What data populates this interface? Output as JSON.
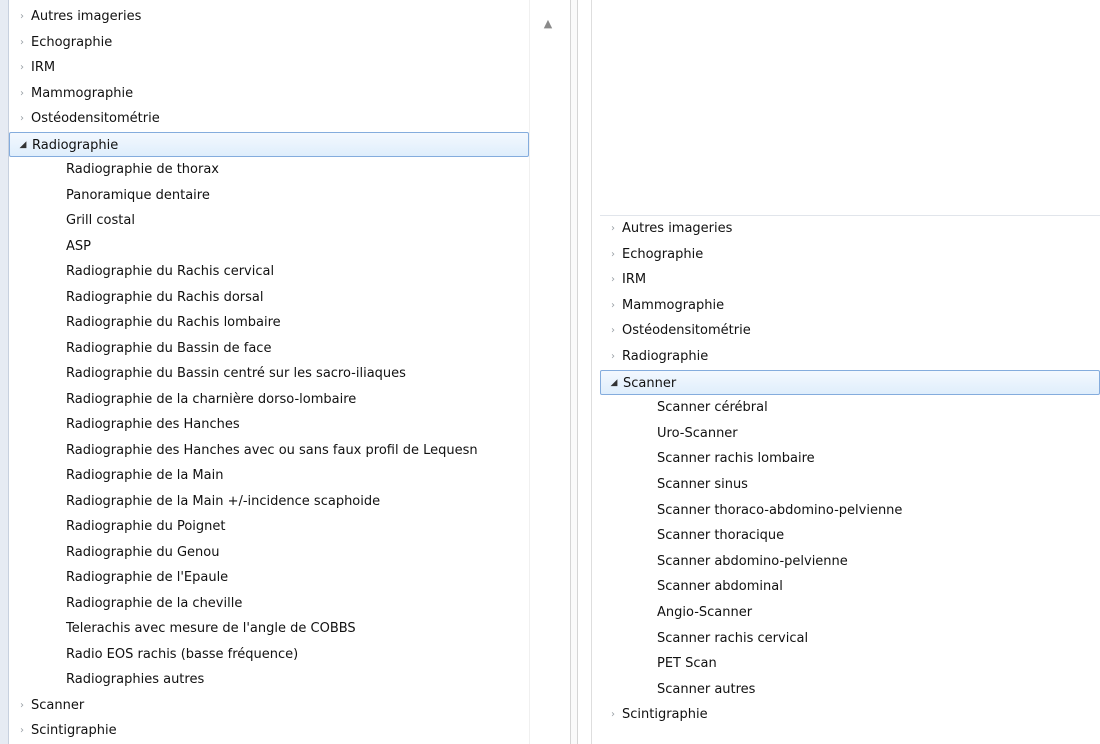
{
  "left_tree": {
    "items": [
      {
        "label": "Autres imageries",
        "level": 0,
        "expanded": false
      },
      {
        "label": "Echographie",
        "level": 0,
        "expanded": false
      },
      {
        "label": "IRM",
        "level": 0,
        "expanded": false
      },
      {
        "label": "Mammographie",
        "level": 0,
        "expanded": false
      },
      {
        "label": "Ostéodensitométrie",
        "level": 0,
        "expanded": false
      },
      {
        "label": "Radiographie",
        "level": 0,
        "expanded": true,
        "selected": true
      },
      {
        "label": "Radiographie de thorax",
        "level": 1
      },
      {
        "label": "Panoramique dentaire",
        "level": 1
      },
      {
        "label": "Grill costal",
        "level": 1
      },
      {
        "label": "ASP",
        "level": 1
      },
      {
        "label": "Radiographie du Rachis cervical",
        "level": 1
      },
      {
        "label": "Radiographie du Rachis dorsal",
        "level": 1
      },
      {
        "label": "Radiographie du Rachis lombaire",
        "level": 1
      },
      {
        "label": "Radiographie du Bassin de face",
        "level": 1
      },
      {
        "label": "Radiographie du Bassin centré sur les sacro-iliaques",
        "level": 1
      },
      {
        "label": "Radiographie de la charnière dorso-lombaire",
        "level": 1
      },
      {
        "label": "Radiographie des Hanches",
        "level": 1
      },
      {
        "label": "Radiographie des Hanches avec ou sans faux profil de Lequesn",
        "level": 1
      },
      {
        "label": "Radiographie de la Main",
        "level": 1
      },
      {
        "label": "Radiographie de la Main +/-incidence scaphoide",
        "level": 1
      },
      {
        "label": "Radiographie du Poignet",
        "level": 1
      },
      {
        "label": "Radiographie du Genou",
        "level": 1
      },
      {
        "label": "Radiographie de l'Epaule",
        "level": 1
      },
      {
        "label": "Radiographie de la cheville",
        "level": 1
      },
      {
        "label": "Telerachis avec mesure de l'angle de COBBS",
        "level": 1
      },
      {
        "label": "Radio EOS rachis (basse fréquence)",
        "level": 1
      },
      {
        "label": "Radiographies autres",
        "level": 1
      },
      {
        "label": "Scanner",
        "level": 0,
        "expanded": false
      },
      {
        "label": "Scintigraphie",
        "level": 0,
        "expanded": false
      }
    ]
  },
  "right_tree": {
    "items": [
      {
        "label": "Autres imageries",
        "level": 0,
        "expanded": false
      },
      {
        "label": "Echographie",
        "level": 0,
        "expanded": false
      },
      {
        "label": "IRM",
        "level": 0,
        "expanded": false
      },
      {
        "label": "Mammographie",
        "level": 0,
        "expanded": false
      },
      {
        "label": "Ostéodensitométrie",
        "level": 0,
        "expanded": false
      },
      {
        "label": "Radiographie",
        "level": 0,
        "expanded": false
      },
      {
        "label": "Scanner",
        "level": 0,
        "expanded": true,
        "selected": true
      },
      {
        "label": "Scanner cérébral",
        "level": 1
      },
      {
        "label": "Uro-Scanner",
        "level": 1
      },
      {
        "label": "Scanner rachis lombaire",
        "level": 1
      },
      {
        "label": "Scanner sinus",
        "level": 1
      },
      {
        "label": "Scanner thoraco-abdomino-pelvienne",
        "level": 1
      },
      {
        "label": "Scanner thoracique",
        "level": 1
      },
      {
        "label": "Scanner abdomino-pelvienne",
        "level": 1
      },
      {
        "label": "Scanner abdominal",
        "level": 1
      },
      {
        "label": "Angio-Scanner",
        "level": 1
      },
      {
        "label": "Scanner rachis cervical",
        "level": 1
      },
      {
        "label": "PET Scan",
        "level": 1
      },
      {
        "label": "Scanner autres",
        "level": 1
      },
      {
        "label": "Scintigraphie",
        "level": 0,
        "expanded": false
      }
    ]
  },
  "glyphs": {
    "collapsed": "›",
    "expanded": "◢",
    "scroll_up": "▲"
  },
  "colors": {
    "selection_border": "#84acdd",
    "selection_fill": "#dfeefc"
  }
}
